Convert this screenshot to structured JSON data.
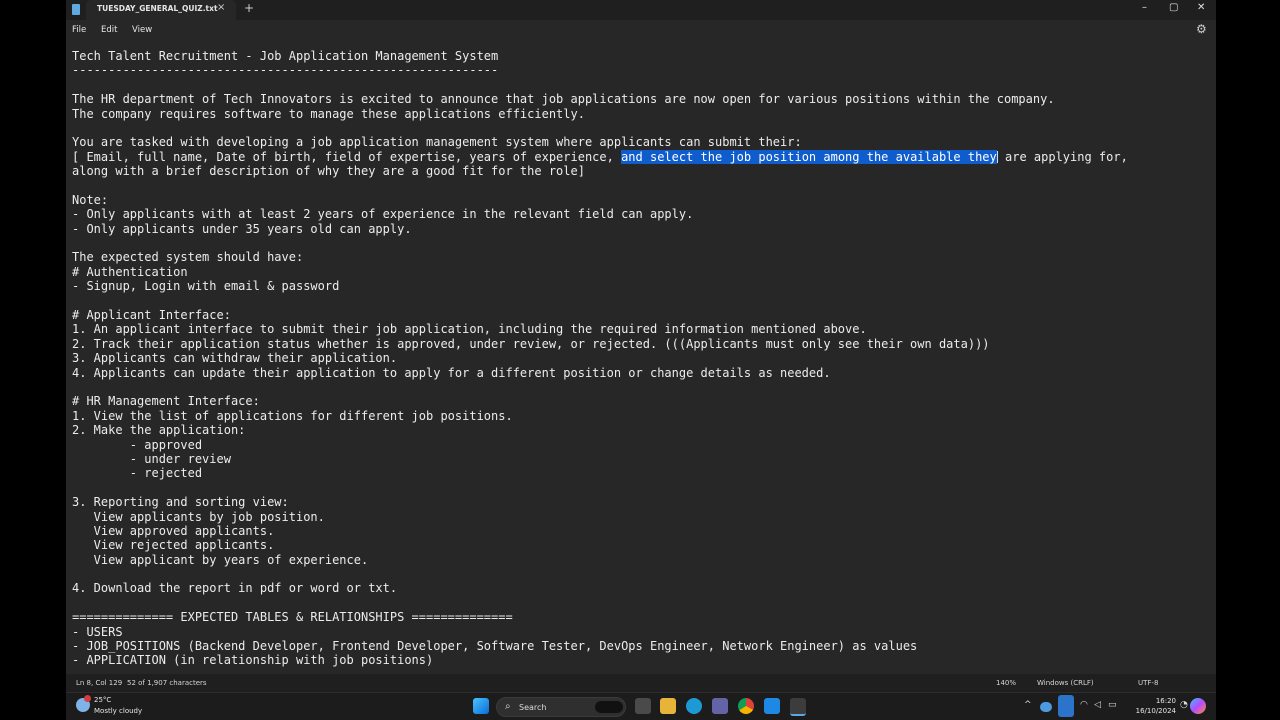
{
  "window": {
    "tab_title": "TUESDAY_GENERAL_QUIZ.txt",
    "close_tab": "×",
    "new_tab": "+",
    "minimize": "–",
    "maximize": "▢",
    "close": "✕"
  },
  "menu": {
    "file": "File",
    "edit": "Edit",
    "view": "View",
    "settings_icon": "⚙"
  },
  "document": {
    "lines": [
      "Tech Talent Recruitment - Job Application Management System",
      "-----------------------------------------------------------",
      "",
      "The HR department of Tech Innovators is excited to announce that job applications are now open for various positions within the company.",
      "The company requires software to manage these applications efficiently.",
      "",
      "You are tasked with developing a job application management system where applicants can submit their:",
      null,
      "along with a brief description of why they are a good fit for the role]",
      "",
      "Note:",
      "- Only applicants with at least 2 years of experience in the relevant field can apply.",
      "- Only applicants under 35 years old can apply.",
      "",
      "The expected system should have:",
      "# Authentication",
      "- Signup, Login with email & password",
      "",
      "# Applicant Interface:",
      "1. An applicant interface to submit their job application, including the required information mentioned above.",
      "2. Track their application status whether is approved, under review, or rejected. (((Applicants must only see their own data)))",
      "3. Applicants can withdraw their application.",
      "4. Applicants can update their application to apply for a different position or change details as needed.",
      "",
      "# HR Management Interface:",
      "1. View the list of applications for different job positions.",
      "2. Make the application:",
      "        - approved",
      "        - under review",
      "        - rejected",
      "",
      "3. Reporting and sorting view:",
      "   View applicants by job position.",
      "   View approved applicants.",
      "   View rejected applicants.",
      "   View applicant by years of experience.",
      "",
      "4. Download the report in pdf or word or txt.",
      "",
      "============== EXPECTED TABLES & RELATIONSHIPS ==============",
      "- USERS",
      "- JOB_POSITIONS (Backend Developer, Frontend Developer, Software Tester, DevOps Engineer, Network Engineer) as values",
      "- APPLICATION (in relationship with job positions)"
    ],
    "line8_before": "[ Email, full name, Date of birth, field of expertise, years of experience, ",
    "line8_selected": "and select the job position among the available they",
    "line8_after": " are applying for,"
  },
  "status": {
    "position": "Ln 8, Col 129",
    "selection": "52 of 1,907 characters",
    "zoom": "140%",
    "line_ending": "Windows (CRLF)",
    "encoding": "UTF-8"
  },
  "taskbar": {
    "weather_temp": "25°C",
    "weather_desc": "Mostly cloudy",
    "search_label": "Search",
    "time": "16:20",
    "date": "16/10/2024",
    "tray_chevron": "^"
  },
  "colors": {
    "selection": "#0f5ccc",
    "editor_bg": "#272727",
    "text": "#ececec"
  }
}
